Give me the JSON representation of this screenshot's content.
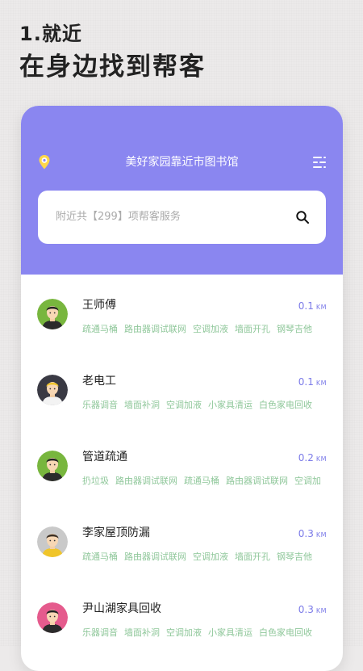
{
  "promo": {
    "step": "1.就近",
    "headline": "在身边找到帮客"
  },
  "app": {
    "location_title": "美好家园靠近市图书馆",
    "search": {
      "placeholder": "附近共【299】项帮客服务"
    },
    "unit": "KM",
    "providers": [
      {
        "name": "王师傅",
        "distance": "0.1",
        "avatar": "avatar-green-bg",
        "tags": [
          "疏通马桶",
          "路由器调试联网",
          "空调加液",
          "墙面开孔",
          "钢琴吉他"
        ]
      },
      {
        "name": "老电工",
        "distance": "0.1",
        "avatar": "avatar-dark-bg",
        "tags": [
          "乐器调音",
          "墙面补洞",
          "空调加液",
          "小家具清运",
          "白色家电回收"
        ]
      },
      {
        "name": "管道疏通",
        "distance": "0.2",
        "avatar": "avatar-green-bg",
        "tags": [
          "扔垃圾",
          "路由器调试联网",
          "疏通马桶",
          "路由器调试联网",
          "空调加"
        ]
      },
      {
        "name": "李家屋顶防漏",
        "distance": "0.3",
        "avatar": "avatar-gray-bg",
        "tags": [
          "疏通马桶",
          "路由器调试联网",
          "空调加液",
          "墙面开孔",
          "钢琴吉他"
        ]
      },
      {
        "name": "尹山湖家具回收",
        "distance": "0.3",
        "avatar": "avatar-pink-bg",
        "tags": [
          "乐器调音",
          "墙面补洞",
          "空调加液",
          "小家具清运",
          "白色家电回收"
        ]
      }
    ]
  },
  "colors": {
    "header": "#8a86f0",
    "tag": "#8fc79a",
    "distance": "#7b7ae8"
  }
}
